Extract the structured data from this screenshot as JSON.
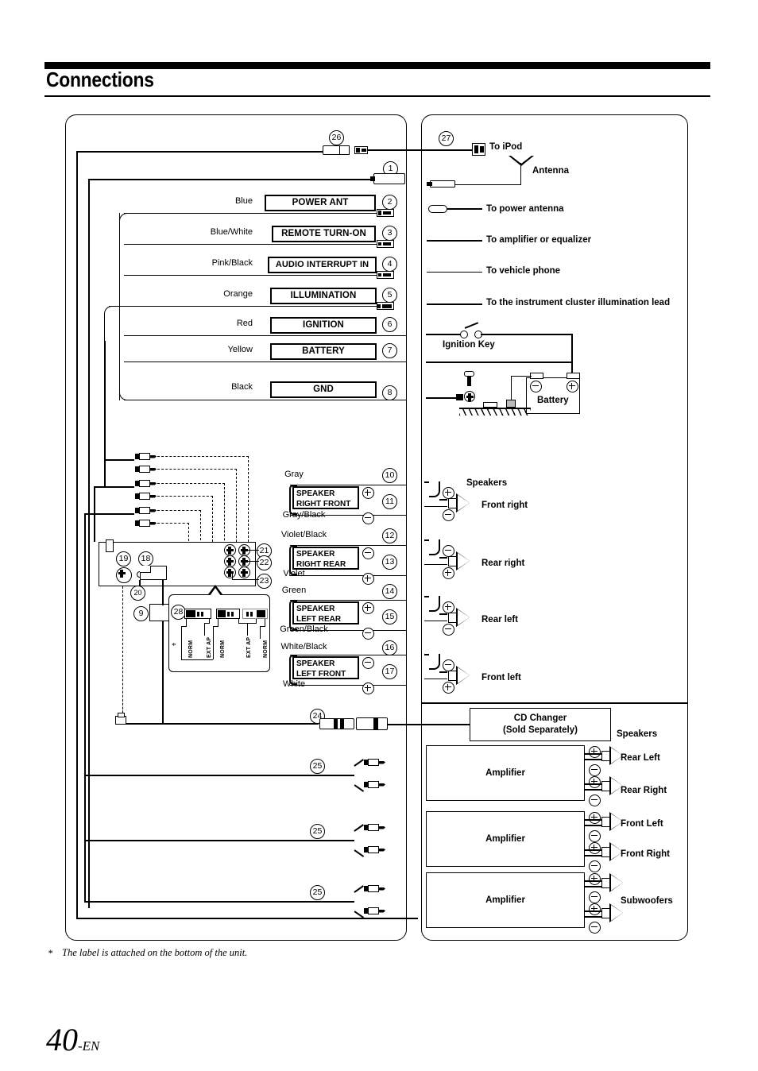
{
  "header": {
    "title": "Connections"
  },
  "footer": {
    "footnote_marker": "*",
    "footnote_text": "The label is attached on the bottom of the unit.",
    "page_number": "40",
    "page_suffix": "-EN"
  },
  "left_panel": {
    "power_wires": [
      {
        "num": "1",
        "color": "",
        "function": ""
      },
      {
        "num": "2",
        "color": "Blue",
        "function": "POWER ANT"
      },
      {
        "num": "3",
        "color": "Blue/White",
        "function": "REMOTE TURN-ON"
      },
      {
        "num": "4",
        "color": "Pink/Black",
        "function": "AUDIO INTERRUPT IN"
      },
      {
        "num": "5",
        "color": "Orange",
        "function": "ILLUMINATION"
      },
      {
        "num": "6",
        "color": "Red",
        "function": "IGNITION"
      },
      {
        "num": "7",
        "color": "Yellow",
        "function": "BATTERY"
      },
      {
        "num": "8",
        "color": "Black",
        "function": "GND"
      }
    ],
    "speaker_wires": [
      {
        "num_top": "10",
        "color_top": "Gray",
        "polarity_top": "plus",
        "num_box": "11",
        "box_line1": "SPEAKER",
        "box_line2": "RIGHT FRONT",
        "color_bot": "Gray/Black",
        "polarity_bot": "minus"
      },
      {
        "num_top": "12",
        "color_top": "Violet/Black",
        "polarity_top": "minus",
        "num_box": "13",
        "box_line1": "SPEAKER",
        "box_line2": "RIGHT REAR",
        "color_bot": "Violet",
        "polarity_bot": "plus"
      },
      {
        "num_top": "14",
        "color_top": "Green",
        "polarity_top": "plus",
        "num_box": "15",
        "box_line1": "SPEAKER",
        "box_line2": "LEFT REAR",
        "color_bot": "Green/Black",
        "polarity_bot": "minus"
      },
      {
        "num_top": "16",
        "color_top": "White/Black",
        "polarity_top": "minus",
        "num_box": "17",
        "box_line1": "SPEAKER",
        "box_line2": "LEFT FRONT",
        "color_bot": "White",
        "polarity_bot": "plus"
      }
    ],
    "connector_numbers": [
      "9",
      "18",
      "19",
      "20",
      "21",
      "22",
      "23",
      "26"
    ],
    "rca_numbers": [
      "24",
      "25",
      "25",
      "25"
    ],
    "label_detail": {
      "num": "28",
      "asterisk": "*",
      "switch_positions": [
        "NORM",
        "EXT AP",
        "NORM",
        "EXT AP",
        "NORM"
      ]
    }
  },
  "right_panel": {
    "ipod_num": "27",
    "ipod_label": "To iPod",
    "antenna_label": "Antenna",
    "leads": [
      "To power antenna",
      "To amplifier or equalizer",
      "To vehicle phone",
      "To the instrument cluster illumination lead"
    ],
    "ignition_key_label": "Ignition Key",
    "battery_label": "Battery",
    "battery_minus": "⊖",
    "battery_plus": "⊕",
    "speakers_heading": "Speakers",
    "speakers": [
      "Front right",
      "Rear right",
      "Rear left",
      "Front left"
    ],
    "cd_changer": {
      "line1": "CD Changer",
      "line2": "(Sold Separately)"
    },
    "amp_speakers_heading": "Speakers",
    "amplifiers": [
      {
        "label": "Amplifier",
        "outputs": [
          "Rear Left",
          "Rear Right"
        ]
      },
      {
        "label": "Amplifier",
        "outputs": [
          "Front Left",
          "Front Right"
        ]
      },
      {
        "label": "Amplifier",
        "outputs": [
          "Subwoofers"
        ]
      }
    ]
  }
}
